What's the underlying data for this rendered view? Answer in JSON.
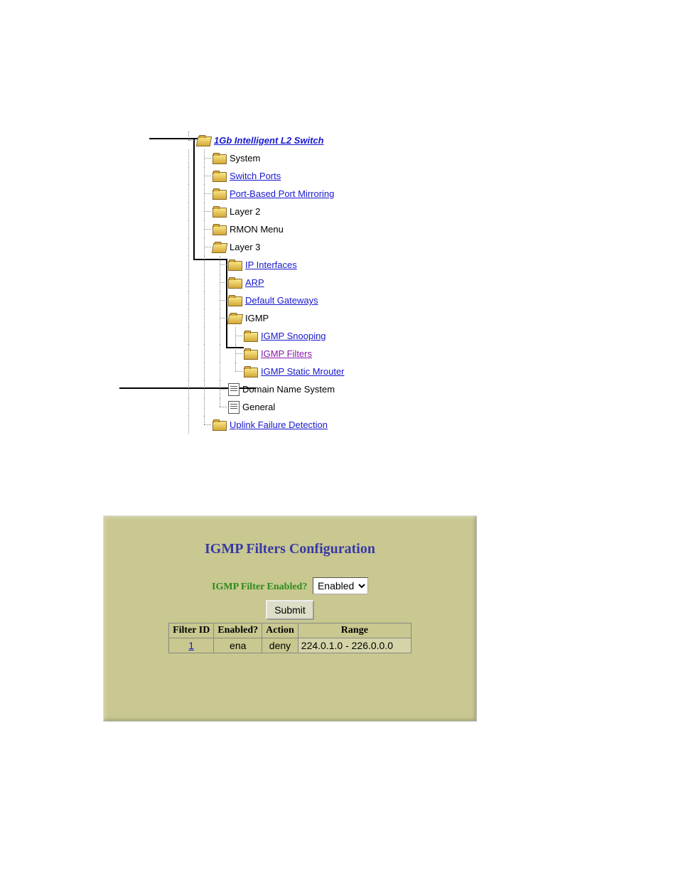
{
  "tree": {
    "root": "1Gb Intelligent L2 Switch",
    "level1": {
      "system": "System",
      "switch_ports": "Switch Ports",
      "port_mirroring": "Port-Based Port Mirroring",
      "layer2": "Layer 2",
      "rmon": "RMON Menu",
      "layer3": "Layer 3",
      "uplink": "Uplink Failure Detection"
    },
    "layer3": {
      "ip_interfaces": "IP Interfaces",
      "arp": "ARP",
      "default_gateways": "Default Gateways",
      "igmp": "IGMP",
      "dns": "Domain Name System",
      "general": "General"
    },
    "igmp": {
      "snooping": "IGMP Snooping",
      "filters": "IGMP Filters",
      "static_mrouter": "IGMP Static Mrouter"
    }
  },
  "panel": {
    "title": "IGMP Filters Configuration",
    "field_label": "IGMP Filter Enabled?",
    "enabled_value": "Enabled",
    "submit": "Submit",
    "table": {
      "headers": {
        "filter_id": "Filter ID",
        "enabled": "Enabled?",
        "action": "Action",
        "range": "Range"
      },
      "row": {
        "filter_id": "1",
        "enabled": "ena",
        "action": "deny",
        "range": "224.0.1.0 - 226.0.0.0"
      }
    }
  }
}
